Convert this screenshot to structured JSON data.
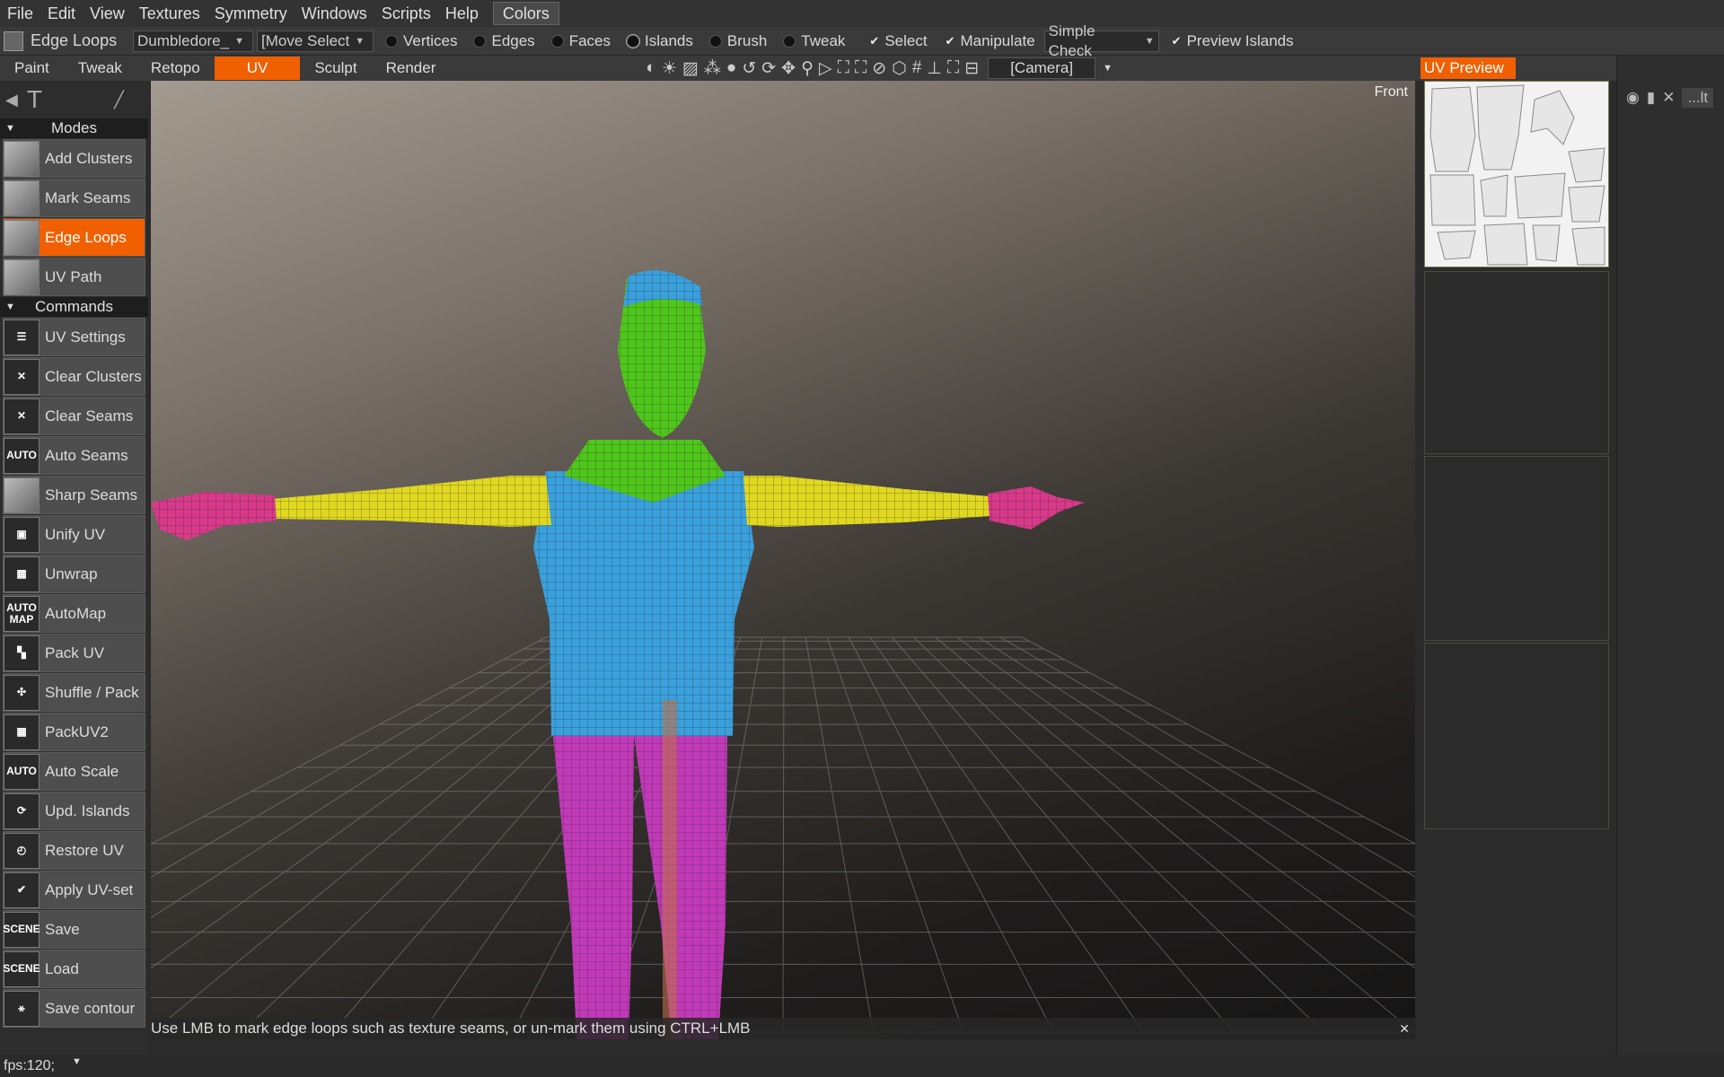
{
  "menu": [
    "File",
    "Edit",
    "View",
    "Textures",
    "Symmetry",
    "Windows",
    "Scripts",
    "Help"
  ],
  "menu_colors": "Colors",
  "toolbar": {
    "tool_name": "Edge  Loops",
    "object_dropdown": "Dumbledore_",
    "mode_dropdown": "[Move  Select",
    "radios": [
      "Vertices",
      "Edges",
      "Faces",
      "Islands",
      "Brush",
      "Tweak"
    ],
    "checks": [
      "Select",
      "Manipulate"
    ],
    "check_mode_dropdown": "Simple  Check",
    "preview_islands": "Preview  Islands"
  },
  "tabs": [
    "Paint",
    "Tweak",
    "Retopo",
    "UV",
    "Sculpt",
    "Render"
  ],
  "active_tab": "UV",
  "camera_dropdown": "[Camera]",
  "uv_preview_tab": "UV  Preview",
  "left_panel": {
    "modes_header": "Modes",
    "modes": [
      {
        "label": "Add  Clusters",
        "icon": "cube-icon",
        "glyph": ""
      },
      {
        "label": "Mark  Seams",
        "icon": "cube-seams-icon",
        "glyph": ""
      },
      {
        "label": "Edge  Loops",
        "icon": "cube-loops-icon",
        "glyph": ""
      },
      {
        "label": "UV  Path",
        "icon": "cube-path-icon",
        "glyph": ""
      }
    ],
    "commands_header": "Commands",
    "commands": [
      {
        "label": "UV  Settings",
        "icon": "sliders-icon",
        "glyph": "☰"
      },
      {
        "label": "Clear  Clusters",
        "icon": "clear-clusters-icon",
        "glyph": "✕"
      },
      {
        "label": "Clear  Seams",
        "icon": "clear-seams-icon",
        "glyph": "✕"
      },
      {
        "label": "Auto  Seams",
        "icon": "auto-icon",
        "glyph": "AUTO"
      },
      {
        "label": "Sharp  Seams",
        "icon": "cube-sharp-icon",
        "glyph": ""
      },
      {
        "label": "Unify  UV",
        "icon": "unify-icon",
        "glyph": "▣"
      },
      {
        "label": "Unwrap",
        "icon": "grid-icon",
        "glyph": "▦"
      },
      {
        "label": "AutoMap",
        "icon": "automap-icon",
        "glyph": "AUTO MAP"
      },
      {
        "label": "Pack  UV",
        "icon": "pack-icon",
        "glyph": "▚"
      },
      {
        "label": "Shuffle / Pack",
        "icon": "shuffle-icon",
        "glyph": "✣"
      },
      {
        "label": "PackUV2",
        "icon": "pack2-icon",
        "glyph": "▦"
      },
      {
        "label": "Auto  Scale",
        "icon": "auto-scale-icon",
        "glyph": "AUTO"
      },
      {
        "label": "Upd.  Islands",
        "icon": "update-icon",
        "glyph": "⟳"
      },
      {
        "label": "Restore  UV",
        "icon": "restore-icon",
        "glyph": "◴"
      },
      {
        "label": "Apply  UV-set",
        "icon": "check-icon",
        "glyph": "✔"
      },
      {
        "label": "Save",
        "icon": "scene-save-icon",
        "glyph": "SCENE"
      },
      {
        "label": "Load",
        "icon": "scene-load-icon",
        "glyph": "SCENE"
      },
      {
        "label": "Save  contour",
        "icon": "contour-icon",
        "glyph": "⚹"
      }
    ]
  },
  "viewport": {
    "view_label": "Front",
    "hint": "Use  LMB  to  mark  edge  loops  such  as  texture  seams,  or  un-mark  them  using  CTRL+LMB"
  },
  "far_right": {
    "label": "...lt"
  },
  "status": "fps:120;",
  "colors": {
    "accent": "#f06000",
    "head": "#4fc61c",
    "torso": "#3aa0dc",
    "arms": "#e0d820",
    "hands": "#d83a8a",
    "legs": "#c03ab8"
  }
}
